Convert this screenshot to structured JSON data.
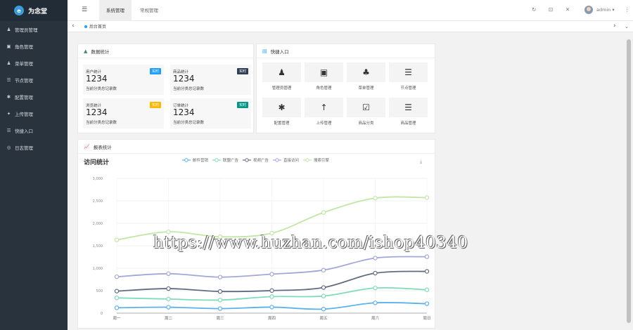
{
  "app": {
    "title": "为念堂",
    "logo_letter": "e"
  },
  "sidebar": {
    "items": [
      {
        "icon": "user-icon",
        "glyph": "♟",
        "label": "管理员管理"
      },
      {
        "icon": "role-icon",
        "glyph": "▣",
        "label": "角色管理"
      },
      {
        "icon": "menu-icon",
        "glyph": "♟",
        "label": "菜单管理"
      },
      {
        "icon": "node-icon",
        "glyph": "☰",
        "label": "节点管理"
      },
      {
        "icon": "config-icon",
        "glyph": "✱",
        "label": "配置管理"
      },
      {
        "icon": "upload-icon",
        "glyph": "✦",
        "label": "上传管理"
      },
      {
        "icon": "quick-icon",
        "glyph": "☰",
        "label": "快捷入口"
      },
      {
        "icon": "log-icon",
        "glyph": "◎",
        "label": "日志管理"
      }
    ]
  },
  "topbar": {
    "tabs": [
      {
        "label": "系统管理",
        "active": true
      },
      {
        "label": "常规管理",
        "active": false
      }
    ],
    "username": "admin ▾"
  },
  "breadcrumb": {
    "home": "后台首页"
  },
  "stats": {
    "title": "数据统计",
    "cards": [
      {
        "label": "用户统计",
        "value": "1234",
        "desc": "当前分类总记录数",
        "badge": "实时",
        "color": "#1e9fff"
      },
      {
        "label": "商品统计",
        "value": "1234",
        "desc": "当前分类总记录数",
        "badge": "实时",
        "color": "#2f4056"
      },
      {
        "label": "浏览统计",
        "value": "1234",
        "desc": "当前分类总记录数",
        "badge": "实时",
        "color": "#ffb800"
      },
      {
        "label": "订单统计",
        "value": "1234",
        "desc": "当前分类总记录数",
        "badge": "实时",
        "color": "#009688"
      }
    ]
  },
  "quick": {
    "title": "快捷入口",
    "items": [
      {
        "icon": "user-icon",
        "glyph": "♟",
        "label": "管理员管理"
      },
      {
        "icon": "role-icon",
        "glyph": "▣",
        "label": "角色管理"
      },
      {
        "icon": "tree-icon",
        "glyph": "♣",
        "label": "菜单管理"
      },
      {
        "icon": "list-icon",
        "glyph": "☰",
        "label": "节点管理"
      },
      {
        "icon": "config-icon",
        "glyph": "✱",
        "label": "配置管理"
      },
      {
        "icon": "upload-icon",
        "glyph": "↑",
        "label": "上传管理"
      },
      {
        "icon": "calendar-icon",
        "glyph": "☑",
        "label": "商品分类"
      },
      {
        "icon": "list-icon",
        "glyph": "☰",
        "label": "商品管理"
      }
    ]
  },
  "report": {
    "title": "报表统计",
    "chart_title": "访问统计"
  },
  "watermark": "https://www.huzhan.com/ishop40340",
  "colors": {
    "accent": "#1e9fff",
    "sidebar": "#28333e"
  },
  "chart_data": {
    "type": "line",
    "title": "访问统计",
    "categories": [
      "周一",
      "周二",
      "周三",
      "周四",
      "周五",
      "周六",
      "周日"
    ],
    "ylim": [
      0,
      3000
    ],
    "yticks": [
      "0",
      "500",
      "1,000",
      "1,500",
      "2,000",
      "2,500",
      "3,000"
    ],
    "grid": true,
    "legend": "top-center",
    "series": [
      {
        "name": "邮件营销",
        "color": "#5ab1ef",
        "values": [
          120,
          132,
          101,
          134,
          90,
          230,
          210
        ]
      },
      {
        "name": "联盟广告",
        "color": "#7fdcb8",
        "values": [
          340,
          314,
          292,
          368,
          380,
          560,
          520
        ]
      },
      {
        "name": "视频广告",
        "color": "#626b82",
        "values": [
          490,
          546,
          483,
          502,
          570,
          890,
          930
        ]
      },
      {
        "name": "直接访问",
        "color": "#a3a7d9",
        "values": [
          810,
          878,
          802,
          868,
          958,
          1226,
          1256
        ]
      },
      {
        "name": "搜索引擎",
        "color": "#c2e6a6",
        "values": [
          1630,
          1810,
          1700,
          1780,
          2240,
          2560,
          2570
        ]
      }
    ]
  }
}
